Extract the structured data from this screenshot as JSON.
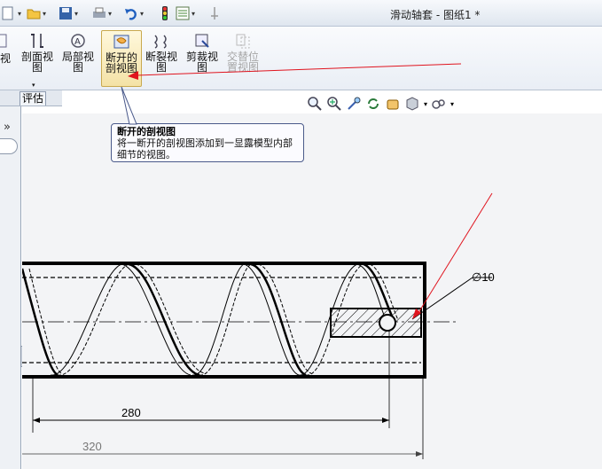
{
  "window": {
    "title": "滑动轴套 - 图纸1 *"
  },
  "ribbon": {
    "buttons": [
      {
        "label": "视"
      },
      {
        "label": "剖面视图"
      },
      {
        "label": "局部视图"
      },
      {
        "label": "断开的剖视图"
      },
      {
        "label": "断裂视图"
      },
      {
        "label": "剪裁视图"
      },
      {
        "label": "交替位置视图"
      }
    ]
  },
  "tabs": {
    "evaluate": "评估"
  },
  "tooltip": {
    "title": "断开的剖视图",
    "description": "将一断开的剖视图添加到一显露模型内部细节的视图。"
  },
  "drawing": {
    "dim_diameter": "∅10",
    "dim_280": "280",
    "dim_320": "320"
  },
  "colors": {
    "annotation_arrow": "#e0141e",
    "tooltip_border": "#4a5a8a"
  }
}
